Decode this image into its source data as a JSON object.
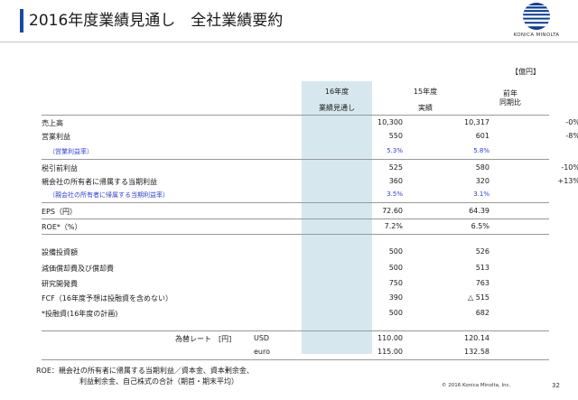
{
  "slide": {
    "title": "2016年度業績見通し　全社業績要約",
    "logo_text": "KONICA MINOLTA",
    "unit": "【億円】",
    "copyright": "© 2016 Konica Minolta, Inc.",
    "page_number": "32"
  },
  "colors": {
    "accent": "#1a4aa0",
    "highlight": "#d6e8ee",
    "sub_text": "#2d3fd6"
  },
  "headers": {
    "col1_line1": "16年度",
    "col1_line2": "業績見通し",
    "col2_line1": "15年度",
    "col2_line2": "実績",
    "col3_line1": "前年",
    "col3_line2": "同期比"
  },
  "rows": [
    {
      "label": "売上高",
      "fy16": "10,300",
      "fy15": "10,317",
      "yoy": "-0%"
    },
    {
      "label": "営業利益",
      "fy16": "550",
      "fy15": "601",
      "yoy": "-8%"
    },
    {
      "label": "（営業利益率）",
      "fy16": "5.3%",
      "fy15": "5.8%",
      "yoy": ""
    },
    {
      "label": "税引前利益",
      "fy16": "525",
      "fy15": "580",
      "yoy": "-10%"
    },
    {
      "label": "親会社の所有者に帰属する当期利益",
      "fy16": "360",
      "fy15": "320",
      "yoy": "+13%"
    },
    {
      "label": "（親会社の所有者に帰属する当期利益率）",
      "fy16": "3.5%",
      "fy15": "3.1%",
      "yoy": ""
    },
    {
      "label": "EPS（円）",
      "fy16": "72.60",
      "fy15": "64.39",
      "yoy": ""
    },
    {
      "label": "ROE*（%）",
      "fy16": "7.2%",
      "fy15": "6.5%",
      "yoy": ""
    },
    {
      "label": "設備投資額",
      "fy16": "500",
      "fy15": "526",
      "yoy": ""
    },
    {
      "label": "減価償却費及び償却費",
      "fy16": "500",
      "fy15": "513",
      "yoy": ""
    },
    {
      "label": "研究開発費",
      "fy16": "750",
      "fy15": "763",
      "yoy": ""
    },
    {
      "label": "FCF（16年度予想は投融資を含めない）",
      "fy16": "390",
      "fy15": "△ 515",
      "yoy": ""
    },
    {
      "label": "*投融資(16年度の計画)",
      "fy16": "500",
      "fy15": "682",
      "yoy": ""
    }
  ],
  "fx": {
    "label": "為替レート　[円]",
    "usd_label": "USD",
    "usd_fy16": "110.00",
    "usd_fy15": "120.14",
    "euro_label": "euro",
    "euro_fy16": "115.00",
    "euro_fy15": "132.58"
  },
  "footnote": {
    "line1": "ROE：親会社の所有者に帰属する当期利益／資本金、資本剰余金、",
    "line2": "利益剰余金、自己株式の合計（期首・期末平均）"
  }
}
